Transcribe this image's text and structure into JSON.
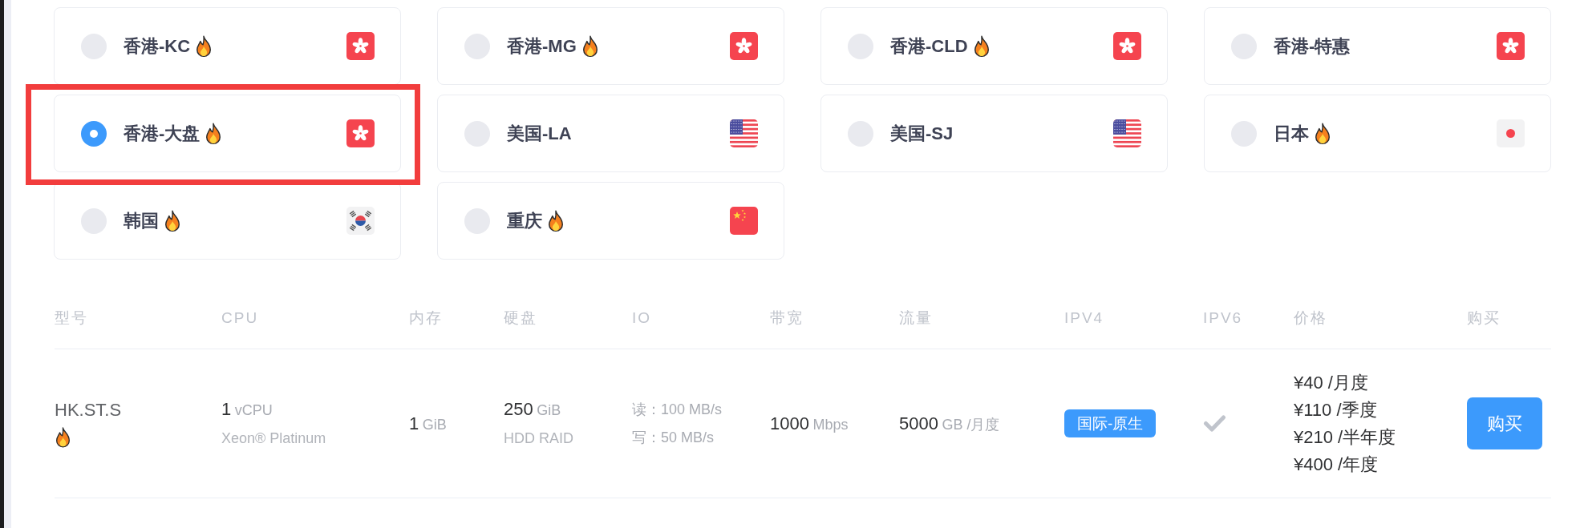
{
  "locations": [
    {
      "label": "香港-KC",
      "hot": true,
      "kind": "hk",
      "selected": false,
      "highlighted": false
    },
    {
      "label": "香港-MG",
      "hot": true,
      "kind": "hk",
      "selected": false,
      "highlighted": false
    },
    {
      "label": "香港-CLD",
      "hot": true,
      "kind": "hk",
      "selected": false,
      "highlighted": false
    },
    {
      "label": "香港-特惠",
      "hot": false,
      "kind": "hk",
      "selected": false,
      "highlighted": false
    },
    {
      "label": "香港-大盘",
      "hot": true,
      "kind": "hk",
      "selected": true,
      "highlighted": true
    },
    {
      "label": "美国-LA",
      "hot": false,
      "kind": "us",
      "selected": false,
      "highlighted": false
    },
    {
      "label": "美国-SJ",
      "hot": false,
      "kind": "us",
      "selected": false,
      "highlighted": false
    },
    {
      "label": "日本",
      "hot": true,
      "kind": "jp",
      "selected": false,
      "highlighted": false
    },
    {
      "label": "韩国",
      "hot": true,
      "kind": "kr",
      "selected": false,
      "highlighted": false
    },
    {
      "label": "重庆",
      "hot": true,
      "kind": "cn",
      "selected": false,
      "highlighted": false
    }
  ],
  "table": {
    "columns": [
      "型号",
      "CPU",
      "内存",
      "硬盘",
      "IO",
      "带宽",
      "流量",
      "IPV4",
      "IPV6",
      "价格",
      "购买"
    ],
    "rows": [
      {
        "model": "HK.ST.S",
        "hot": true,
        "cpu": {
          "value": "1",
          "unit": "vCPU",
          "detail": "Xeon® Platinum"
        },
        "memory": {
          "value": "1",
          "unit": "GiB"
        },
        "disk": {
          "value": "250",
          "unit": "GiB",
          "detail": "HDD RAID"
        },
        "io": [
          "读：100 MB/s",
          "写：50 MB/s"
        ],
        "bandwidth": {
          "value": "1000",
          "unit": "Mbps"
        },
        "traffic": {
          "value": "5000",
          "unit": "GB /月度"
        },
        "ipv4": "国际-原生",
        "ipv6": true,
        "prices": [
          "¥40 /月度",
          "¥110 /季度",
          "¥210 /半年度",
          "¥400 /年度"
        ],
        "buy_button": "购买"
      }
    ]
  }
}
